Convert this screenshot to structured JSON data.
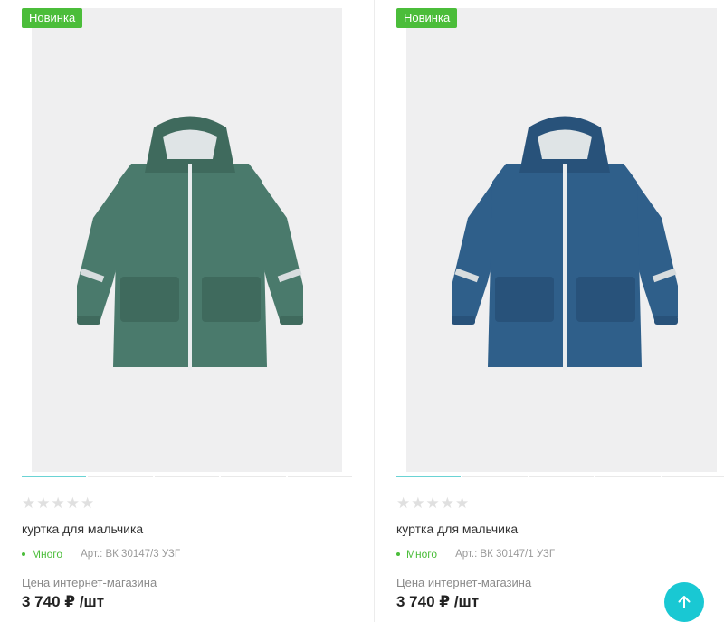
{
  "products": [
    {
      "badge": "Новинка",
      "stars": "★★★★★",
      "title": "куртка для мальчика",
      "stock": "Много",
      "article": "Арт.: ВК 30147/3 УЗГ",
      "price_label": "Цена интернет-магазина",
      "price": "3 740 ₽ /шт",
      "image_slides": 5,
      "active_slide": 1,
      "jacket_color": "#4a7a6c",
      "jacket_shade": "#3f6a5d"
    },
    {
      "badge": "Новинка",
      "stars": "★★★★★",
      "title": "куртка для мальчика",
      "stock": "Много",
      "article": "Арт.: ВК 30147/1 УЗГ",
      "price_label": "Цена интернет-магазина",
      "price": "3 740 ₽ /шт",
      "image_slides": 5,
      "active_slide": 1,
      "jacket_color": "#2f5f8a",
      "jacket_shade": "#28527a"
    }
  ],
  "scroll_top": {
    "icon": "arrow-up-icon"
  },
  "colors": {
    "accent": "#19c8d3",
    "new_badge": "#4bbd3a",
    "stock": "#4bbd3a"
  }
}
